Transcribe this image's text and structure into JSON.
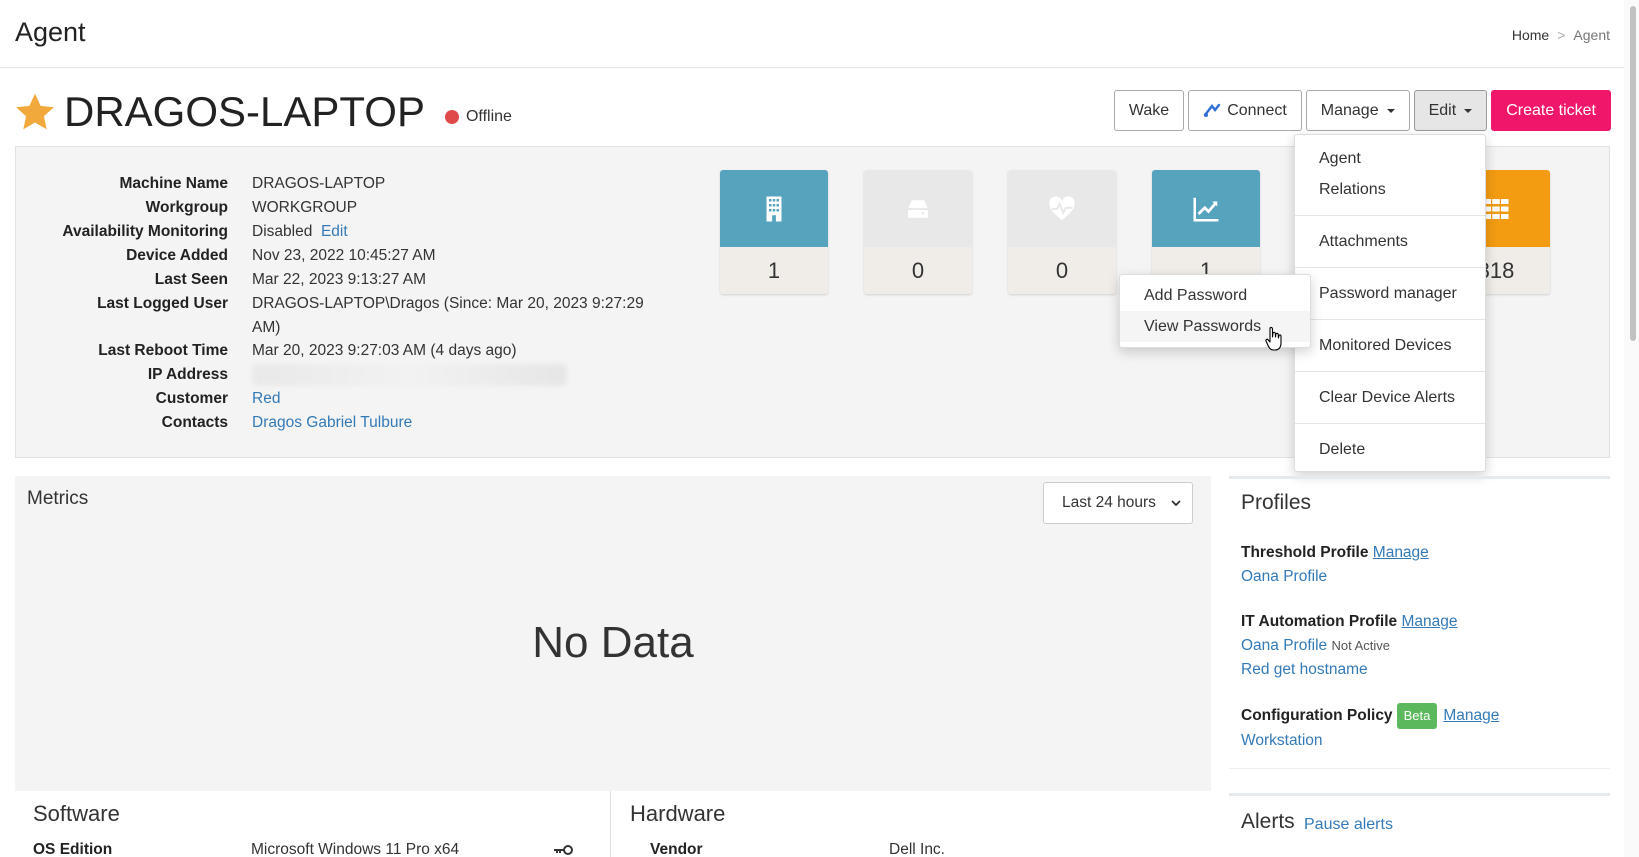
{
  "header": {
    "title": "Agent",
    "breadcrumb": {
      "home": "Home",
      "sep": ">",
      "current": "Agent"
    }
  },
  "device": {
    "name": "DRAGOS-LAPTOP",
    "status": "Offline",
    "status_color": "#e04a4a",
    "favorite_icon": "star-icon"
  },
  "actions": {
    "wake": "Wake",
    "connect": "Connect",
    "manage": "Manage",
    "edit": "Edit",
    "create_ticket": "Create ticket"
  },
  "info": {
    "machine_name": {
      "label": "Machine Name",
      "value": "DRAGOS-LAPTOP"
    },
    "workgroup": {
      "label": "Workgroup",
      "value": "WORKGROUP"
    },
    "availability": {
      "label": "Availability Monitoring",
      "value": "Disabled",
      "edit": "Edit"
    },
    "device_added": {
      "label": "Device Added",
      "value": "Nov 23, 2022 10:45:27 AM"
    },
    "last_seen": {
      "label": "Last Seen",
      "value": "Mar 22, 2023 9:13:27 AM"
    },
    "last_logged_user": {
      "label": "Last Logged User",
      "value": "DRAGOS-LAPTOP\\Dragos (Since: Mar 20, 2023 9:27:29 AM)"
    },
    "last_reboot": {
      "label": "Last Reboot Time",
      "value": "Mar 20, 2023 9:27:03 AM (4 days ago)"
    },
    "ip_address": {
      "label": "IP Address"
    },
    "customer": {
      "label": "Customer",
      "value": "Red"
    },
    "contacts": {
      "label": "Contacts",
      "value": "Dragos Gabriel Tulbure"
    }
  },
  "tiles": [
    {
      "icon": "building-icon",
      "value": "1",
      "color": "#55a3bd"
    },
    {
      "icon": "drive-icon",
      "value": "0",
      "color": "#e8e8e8"
    },
    {
      "icon": "heartbeat-icon",
      "value": "0",
      "color": "#e8e8e8"
    },
    {
      "icon": "chart-icon",
      "value": "1",
      "color": "#55a3bd"
    },
    {
      "icon": "apps-icon",
      "value": "818",
      "color": "#f39c12"
    }
  ],
  "edit_menu": {
    "items": [
      "Agent",
      "Relations",
      "Attachments",
      "Password manager",
      "Monitored Devices",
      "Clear Device Alerts",
      "Delete"
    ]
  },
  "password_submenu": {
    "items": [
      "Add Password",
      "View Passwords"
    ]
  },
  "metrics": {
    "title": "Metrics",
    "range": "Last 24 hours",
    "empty": "No Data"
  },
  "software": {
    "title": "Software",
    "os_label": "OS Edition",
    "os_value": "Microsoft Windows 11 Pro x64"
  },
  "hardware": {
    "title": "Hardware",
    "vendor_label": "Vendor",
    "vendor_value": "Dell Inc."
  },
  "profiles": {
    "title": "Profiles",
    "threshold": {
      "label": "Threshold Profile",
      "manage": "Manage",
      "name": "Oana Profile"
    },
    "automation": {
      "label": "IT Automation Profile",
      "manage": "Manage",
      "name": "Oana Profile",
      "note": "Not Active",
      "extra": "Red get hostname"
    },
    "config": {
      "label": "Configuration Policy",
      "badge": "Beta",
      "manage": "Manage",
      "name": "Workstation"
    }
  },
  "alerts": {
    "title": "Alerts",
    "pause": "Pause alerts"
  }
}
